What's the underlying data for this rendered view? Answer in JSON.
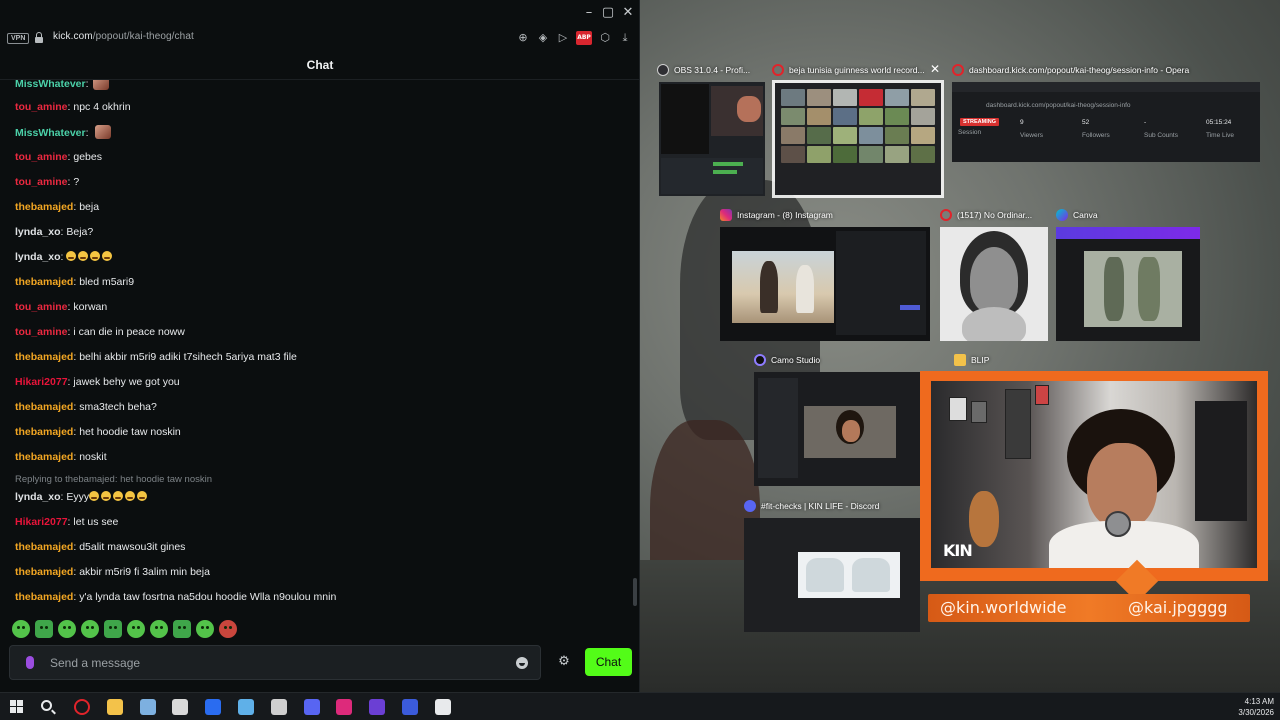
{
  "browser": {
    "vpn_label": "VPN",
    "url_host": "kick.com",
    "url_path": "/popout/kai-theog/chat",
    "abp_label": "ABP",
    "window_controls": [
      "–",
      "▢",
      "✕"
    ]
  },
  "chat": {
    "title": "Chat",
    "partial_top": {
      "user": "MissWhatever",
      "color": "#4bd0a8"
    },
    "messages": [
      {
        "user": "tou_amine",
        "color": "#ea2940",
        "text": "npc 4 okhrin",
        "emotes": 0
      },
      {
        "user": "MissWhatever",
        "color": "#4bd0a8",
        "text": "",
        "avatar": true,
        "emotes": 0
      },
      {
        "user": "tou_amine",
        "color": "#ea2940",
        "text": "gebes",
        "emotes": 0
      },
      {
        "user": "tou_amine",
        "color": "#ea2940",
        "text": "?",
        "emotes": 0
      },
      {
        "user": "thebamajed",
        "color": "#f2a623",
        "text": "beja",
        "emotes": 0
      },
      {
        "user": "lynda_xo",
        "color": "#dfe2e4",
        "text": "Beja?",
        "emotes": 0
      },
      {
        "user": "lynda_xo",
        "color": "#dfe2e4",
        "text": "",
        "emotes": 4
      },
      {
        "user": "thebamajed",
        "color": "#f2a623",
        "text": "bled m5ari9",
        "emotes": 0
      },
      {
        "user": "tou_amine",
        "color": "#ea2940",
        "text": "korwan",
        "emotes": 0
      },
      {
        "user": "tou_amine",
        "color": "#ea2940",
        "text": "i can die in peace noww",
        "emotes": 0
      },
      {
        "user": "thebamajed",
        "color": "#f2a623",
        "text": "belhi akbir m5ri9 adiki t7sihech 5ariya mat3 file",
        "emotes": 0
      },
      {
        "user": "Hikari2077",
        "color": "#e8143a",
        "text": "jawek behy we got you",
        "emotes": 0
      },
      {
        "user": "thebamajed",
        "color": "#f2a623",
        "text": "sma3tech beha?",
        "emotes": 0
      },
      {
        "user": "thebamajed",
        "color": "#f2a623",
        "text": "het hoodie taw noskin",
        "emotes": 0
      },
      {
        "user": "thebamajed",
        "color": "#f2a623",
        "text": "noskit",
        "emotes": 0
      },
      {
        "user": "lynda_xo",
        "color": "#dfe2e4",
        "text": "Eyyy",
        "emotes": 5,
        "reply_to": "Replying to thebamajed: het hoodie taw noskin"
      },
      {
        "user": "Hikari2077",
        "color": "#e8143a",
        "text": "let us see",
        "emotes": 0
      },
      {
        "user": "thebamajed",
        "color": "#f2a623",
        "text": "d5alit mawsou3it gines",
        "emotes": 0
      },
      {
        "user": "thebamajed",
        "color": "#f2a623",
        "text": "akbir m5ri9 fi 3alim min beja",
        "emotes": 0
      },
      {
        "user": "thebamajed",
        "color": "#f2a623",
        "text": "y'a lynda taw fosrtna na5dou hoodie Wlla n9oulou mnin",
        "emotes": 0
      }
    ],
    "quick_emotes": [
      "kick-emote-1",
      "kick-emote-2",
      "kick-emote-3",
      "kick-emote-4",
      "kick-emote-5",
      "kick-emote-6",
      "kick-emote-7",
      "kick-emote-8",
      "kick-emote-9",
      "kick-emote-10"
    ],
    "input_placeholder": "Send a message",
    "send_label": "Chat",
    "accent_color": "#53fc18"
  },
  "task_switcher": {
    "windows": [
      {
        "id": "obs",
        "title": "OBS 31.0.4 - Profi...",
        "icon": "obs-icon"
      },
      {
        "id": "opera-search",
        "title": "beja tunisia guinness world record...",
        "icon": "opera-icon",
        "selected": true
      },
      {
        "id": "opera-dashboard",
        "title": "dashboard.kick.com/popout/kai-theog/session-info - Opera",
        "icon": "opera-icon"
      },
      {
        "id": "instagram",
        "title": "Instagram - (8) Instagram",
        "icon": "instagram-icon"
      },
      {
        "id": "noordinary",
        "title": "(1517) No Ordinar...",
        "icon": "opera-icon"
      },
      {
        "id": "canva",
        "title": "Canva",
        "icon": "canva-icon"
      },
      {
        "id": "camo",
        "title": "Camo Studio",
        "icon": "camo-icon"
      },
      {
        "id": "blip",
        "title": "BLIP",
        "icon": "folder-icon"
      },
      {
        "id": "discord",
        "title": "#fit-checks | KIN LIFE - Discord",
        "icon": "discord-icon"
      }
    ],
    "dashboard": {
      "url": "dashboard.kick.com/popout/kai-theog/session-info",
      "status": "STREAMING",
      "status_label": "Session",
      "stats": [
        {
          "value": "9",
          "label": "Viewers"
        },
        {
          "value": "52",
          "label": "Followers"
        },
        {
          "value": "-",
          "label": "Sub Counts"
        },
        {
          "value": "05:15:24",
          "label": "Time Live"
        }
      ]
    }
  },
  "overlay": {
    "logo_text": "KIN",
    "handle_left": "@kin.worldwide",
    "handle_right": "@kai.jpgggg",
    "frame_color": "#ef6a1e"
  },
  "taskbar": {
    "apps": [
      "opera-icon",
      "file-explorer-icon",
      "browser-icon",
      "chatgpt-icon",
      "shield-app-icon",
      "paint-icon",
      "obs-icon",
      "discord-icon",
      "instagram-icon",
      "bravo-icon",
      "camo-icon",
      "notepad-icon"
    ],
    "time": "4:13 AM",
    "date": "3/30/2026"
  }
}
